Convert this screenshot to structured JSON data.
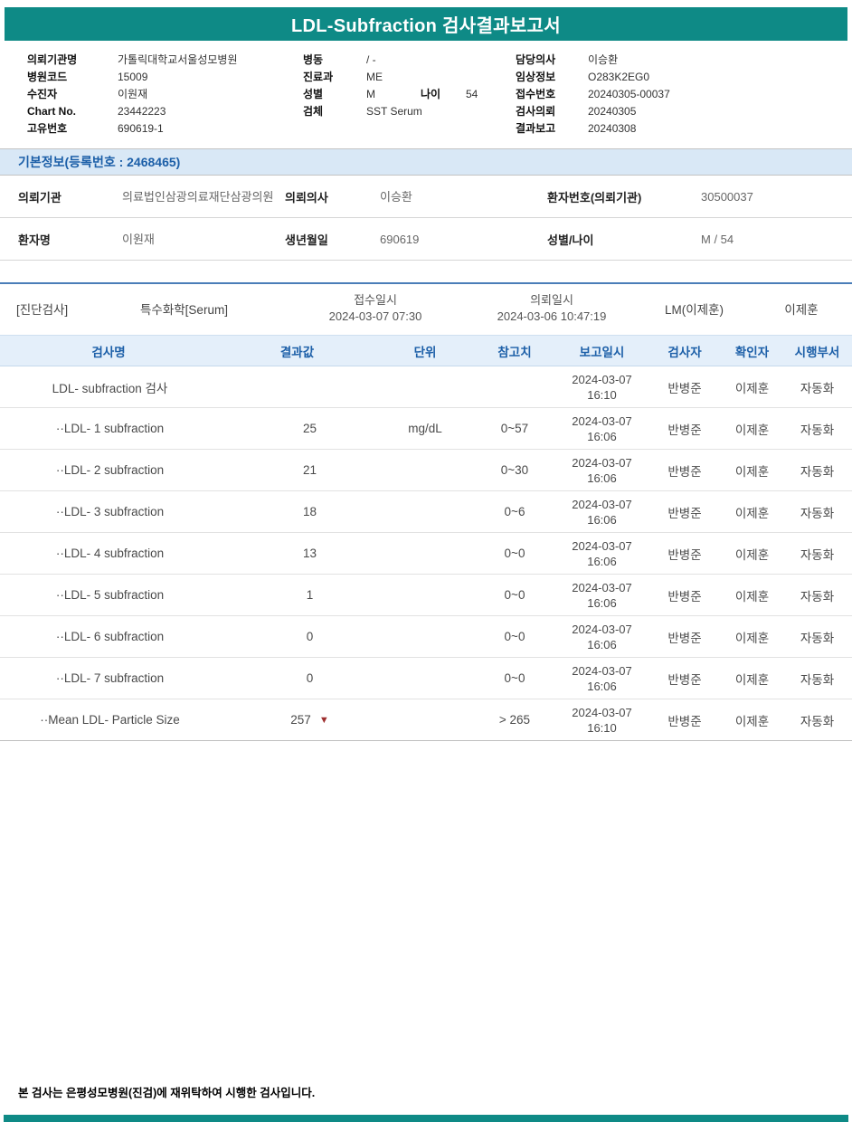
{
  "colors": {
    "teal": "#0E8A86",
    "header_blue": "#1C5FA8",
    "section_bg": "#D9E8F6",
    "table_header_bg": "#E4EFFA",
    "marker_red": "#9E2F2F"
  },
  "title": "LDL-Subfraction 검사결과보고서",
  "patient": {
    "left": [
      {
        "label": "의뢰기관명",
        "value": "가톨릭대학교서울성모병원"
      },
      {
        "label": "병원코드",
        "value": "15009"
      },
      {
        "label": "수진자",
        "value": "이원재"
      },
      {
        "label": "Chart No.",
        "value": "23442223"
      },
      {
        "label": "고유번호",
        "value": "690619-1"
      }
    ],
    "middle": [
      {
        "label": "병동",
        "value": "/ -"
      },
      {
        "label": "진료과",
        "value": "ME"
      },
      {
        "label": "성별",
        "value": "M",
        "label2": "나이",
        "value2": "54"
      },
      {
        "label": "검체",
        "value": "SST Serum"
      }
    ],
    "right": [
      {
        "label": "담당의사",
        "value": "이승환"
      },
      {
        "label": "임상정보",
        "value": "O283K2EG0"
      },
      {
        "label": "접수번호",
        "value": "20240305-00037"
      },
      {
        "label": "검사의뢰",
        "value": "20240305"
      },
      {
        "label": "결과보고",
        "value": "20240308"
      }
    ]
  },
  "basic_info": {
    "section_title": "기본정보(등록번호 : 2468465)",
    "rows": [
      [
        {
          "label": "의뢰기관",
          "value": "의료법인삼광의료재단삼광의원"
        },
        {
          "label": "의뢰의사",
          "value": "이승환"
        },
        {
          "label": "환자번호(의뢰기관)",
          "value": "30500037"
        }
      ],
      [
        {
          "label": "환자명",
          "value": "이원재"
        },
        {
          "label": "생년월일",
          "value": "690619"
        },
        {
          "label": "성별/나이",
          "value": "M / 54"
        }
      ]
    ]
  },
  "lab_info": {
    "category": "[진단검사]",
    "test_group": "특수화학[Serum]",
    "receipt_label": "접수일시",
    "receipt_time": "2024-03-07 07:30",
    "request_label": "의뢰일시",
    "request_time": "2024-03-06 10:47:19",
    "department": "LM(이제훈)",
    "director": "이제훈"
  },
  "results": {
    "columns": [
      "검사명",
      "결과값",
      "단위",
      "참고치",
      "보고일시",
      "검사자",
      "확인자",
      "시행부서"
    ],
    "rows": [
      {
        "name": "LDL- subfraction 검사",
        "result": "",
        "unit": "",
        "ref": "",
        "reported": "2024-03-07 16:10",
        "tester": "반병준",
        "confirmer": "이제훈",
        "dept": "자동화"
      },
      {
        "name": "··LDL- 1 subfraction",
        "result": "25",
        "unit": "mg/dL",
        "ref": "0~57",
        "reported": "2024-03-07 16:06",
        "tester": "반병준",
        "confirmer": "이제훈",
        "dept": "자동화"
      },
      {
        "name": "··LDL- 2 subfraction",
        "result": "21",
        "unit": "",
        "ref": "0~30",
        "reported": "2024-03-07 16:06",
        "tester": "반병준",
        "confirmer": "이제훈",
        "dept": "자동화"
      },
      {
        "name": "··LDL- 3 subfraction",
        "result": "18",
        "unit": "",
        "ref": "0~6",
        "reported": "2024-03-07 16:06",
        "tester": "반병준",
        "confirmer": "이제훈",
        "dept": "자동화"
      },
      {
        "name": "··LDL- 4 subfraction",
        "result": "13",
        "unit": "",
        "ref": "0~0",
        "reported": "2024-03-07 16:06",
        "tester": "반병준",
        "confirmer": "이제훈",
        "dept": "자동화"
      },
      {
        "name": "··LDL- 5 subfraction",
        "result": "1",
        "unit": "",
        "ref": "0~0",
        "reported": "2024-03-07 16:06",
        "tester": "반병준",
        "confirmer": "이제훈",
        "dept": "자동화"
      },
      {
        "name": "··LDL- 6 subfraction",
        "result": "0",
        "unit": "",
        "ref": "0~0",
        "reported": "2024-03-07 16:06",
        "tester": "반병준",
        "confirmer": "이제훈",
        "dept": "자동화"
      },
      {
        "name": "··LDL- 7 subfraction",
        "result": "0",
        "unit": "",
        "ref": "0~0",
        "reported": "2024-03-07 16:06",
        "tester": "반병준",
        "confirmer": "이제훈",
        "dept": "자동화"
      },
      {
        "name": "··Mean LDL- Particle Size",
        "result": "257",
        "marker": "▼",
        "unit": "",
        "ref": "> 265",
        "reported": "2024-03-07 16:10",
        "tester": "반병준",
        "confirmer": "이제훈",
        "dept": "자동화"
      }
    ]
  },
  "footer": {
    "note": "본 검사는 은평성모병원(진검)에 재위탁하여 시행한 검사입니다."
  }
}
